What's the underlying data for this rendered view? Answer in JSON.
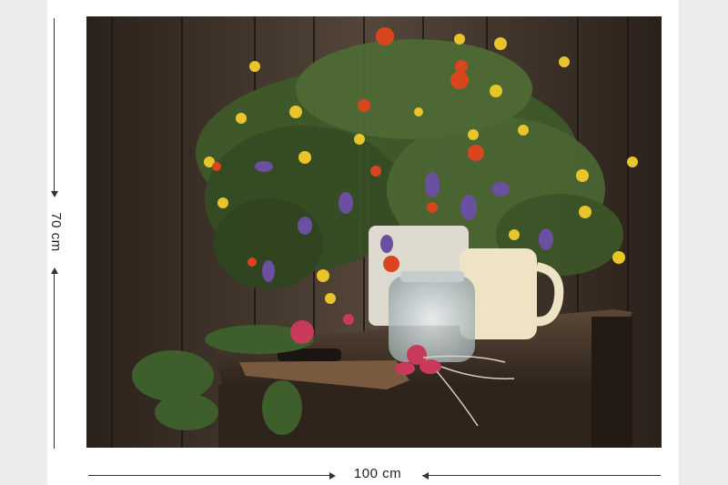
{
  "product": {
    "height_label": "70 cm",
    "width_label": "100 cm"
  },
  "colors": {
    "wall": "#3a2e24",
    "table": "#4a3a2c",
    "foliage": "#3f5a2a",
    "flower_yellow": "#e8c52a",
    "flower_orange": "#d9461e",
    "flower_purple": "#6b4fa0",
    "mug": "#efe3c6",
    "radish": "#c93a5a"
  }
}
